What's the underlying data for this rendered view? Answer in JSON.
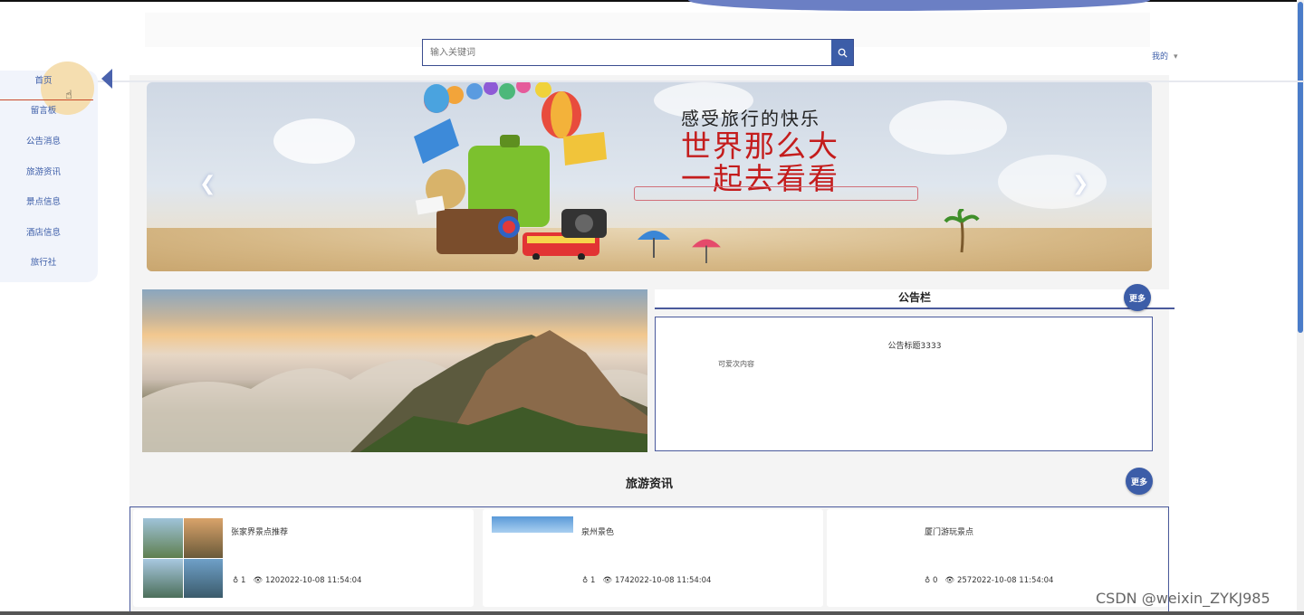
{
  "header": {
    "search_placeholder": "输入关键词",
    "mine_label": "我的",
    "mine_caret": "▾"
  },
  "sidebar": {
    "items": [
      {
        "label": "首页"
      },
      {
        "label": "留言板"
      },
      {
        "label": "公告消息"
      },
      {
        "label": "旅游资讯"
      },
      {
        "label": "景点信息"
      },
      {
        "label": "酒店信息"
      },
      {
        "label": "旅行社"
      }
    ]
  },
  "banner": {
    "line1": "感受旅行的快乐",
    "line2": "世界那么大",
    "line3": "一起去看看",
    "prev": "❮",
    "next": "❯"
  },
  "notice": {
    "title": "公告栏",
    "more_label": "更多",
    "item_title": "公告标题3333",
    "item_content": "可爱次内容"
  },
  "news": {
    "title": "旅游资讯",
    "more_label": "更多",
    "items": [
      {
        "title": "张家界景点推荐",
        "likes": "1",
        "meta": "1202022-10-08 11:54:04"
      },
      {
        "title": "泉州景色",
        "likes": "1",
        "meta": "1742022-10-08 11:54:04"
      },
      {
        "title": "厦门游玩景点",
        "likes": "0",
        "meta": "2572022-10-08 11:54:04"
      }
    ]
  },
  "watermark": "CSDN @weixin_ZYKJ985",
  "colors": {
    "accent": "#3c5da8",
    "border": "#4a5a9c",
    "page_bg": "#f4f4f4"
  }
}
